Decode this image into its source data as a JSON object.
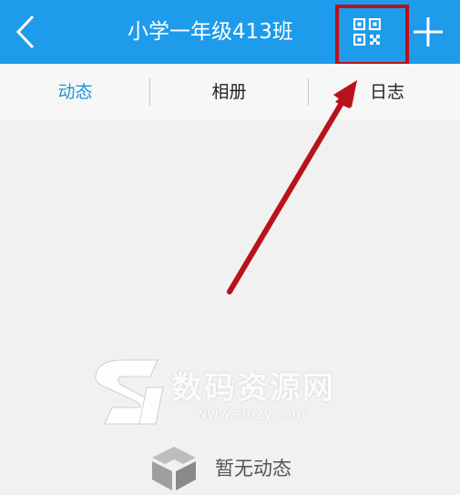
{
  "header": {
    "title": "小学一年级413班",
    "back_icon": "chevron-left-icon",
    "qr_icon": "qr-code-icon",
    "add_icon": "plus-icon",
    "bar_color": "#1e9bea"
  },
  "tabs": [
    {
      "label": "动态",
      "active": true
    },
    {
      "label": "相册",
      "active": false
    },
    {
      "label": "日志",
      "active": false
    }
  ],
  "annotation": {
    "color": "#b8121a"
  },
  "watermark": {
    "text": "数码资源网",
    "url": "www.smzy.com"
  },
  "empty_state": {
    "icon": "empty-box-icon",
    "text": "暂无动态"
  }
}
